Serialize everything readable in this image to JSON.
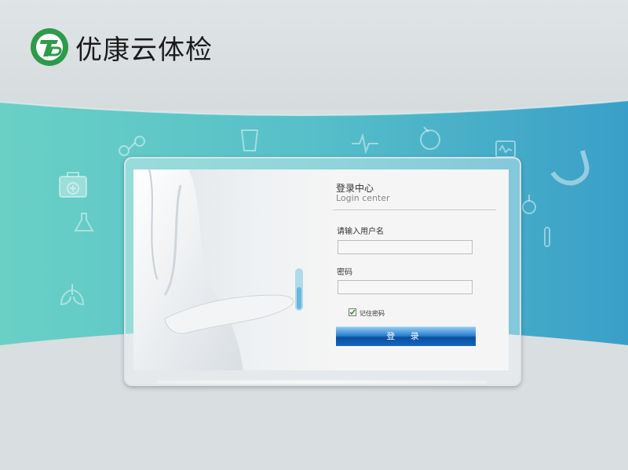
{
  "brand": {
    "name": "优康云体检"
  },
  "login": {
    "title": "登录中心",
    "subtitle": "Login center",
    "username_label": "请输入用户名",
    "username_value": "",
    "password_label": "密码",
    "password_value": "",
    "remember_label": "记住密码",
    "remember_checked": true,
    "submit_label": "登 录"
  },
  "colors": {
    "band_left": "#6ad0c6",
    "band_right": "#3a9fc8",
    "button": "#1660b8",
    "logo_green": "#2e9a4a"
  },
  "icons": [
    "logo-icon",
    "medical-kit-icon",
    "flask-icon",
    "lungs-icon",
    "heartbeat-icon",
    "stomach-icon",
    "test-tube-icon",
    "glasses-icon",
    "beaker-icon",
    "monitor-icon",
    "checkmark-icon"
  ]
}
